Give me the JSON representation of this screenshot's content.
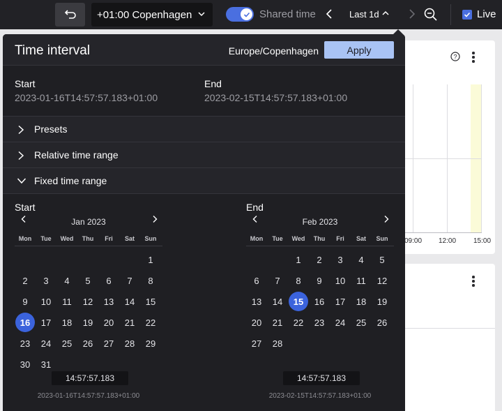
{
  "toolbar": {
    "timezone": "+01:00 Copenhagen",
    "shared_time_label": "Shared time",
    "range_label": "Last 1d",
    "live_label": "Live"
  },
  "chart_panel": {
    "x_ticks": [
      "09:00",
      "12:00",
      "15:00"
    ]
  },
  "popover": {
    "title": "Time interval",
    "timezone": "Europe/Copenhagen",
    "apply_label": "Apply",
    "start_label": "Start",
    "start_value": "2023-01-16T14:57:57.183+01:00",
    "end_label": "End",
    "end_value": "2023-02-15T14:57:57.183+01:00",
    "sections": {
      "presets": "Presets",
      "relative": "Relative time range",
      "fixed": "Fixed time range"
    },
    "start_cal": {
      "title": "Start",
      "month": "Jan 2023",
      "first_weekday": 6,
      "days_in_month": 31,
      "selected": 16,
      "time": "14:57:57.183",
      "iso": "2023-01-16T14:57:57.183+01:00"
    },
    "end_cal": {
      "title": "End",
      "month": "Feb 2023",
      "first_weekday": 2,
      "days_in_month": 28,
      "selected": 15,
      "time": "14:57:57.183",
      "iso": "2023-02-15T14:57:57.183+01:00"
    },
    "weekdays": [
      "Mon",
      "Tue",
      "Wed",
      "Thu",
      "Fri",
      "Sat",
      "Sun"
    ]
  },
  "colors": {
    "accent": "#3b63dc",
    "apply_bg": "#a9c3f4",
    "popover_bg": "#1f1f23"
  }
}
